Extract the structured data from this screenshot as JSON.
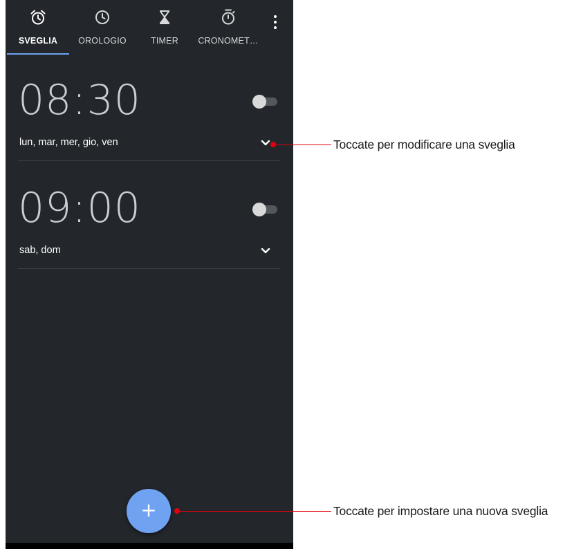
{
  "tabs": [
    {
      "label": "SVEGLIA",
      "icon": "alarm-clock-icon",
      "active": true
    },
    {
      "label": "OROLOGIO",
      "icon": "clock-icon",
      "active": false
    },
    {
      "label": "TIMER",
      "icon": "hourglass-icon",
      "active": false
    },
    {
      "label": "CRONOMET…",
      "icon": "stopwatch-icon",
      "active": false
    }
  ],
  "alarms": [
    {
      "time": "08:30",
      "days": "lun, mar, mer, gio, ven",
      "enabled": false
    },
    {
      "time": "09:00",
      "days": "sab, dom",
      "enabled": false
    }
  ],
  "fab": {
    "label": "+",
    "icon": "plus-icon"
  },
  "callouts": {
    "edit": "Toccate per modificare una sveglia",
    "add": "Toccate per impostare una nuova sveglia"
  },
  "colors": {
    "background": "#23272b",
    "accent": "#6fa3f2",
    "callout": "#e2000f"
  }
}
